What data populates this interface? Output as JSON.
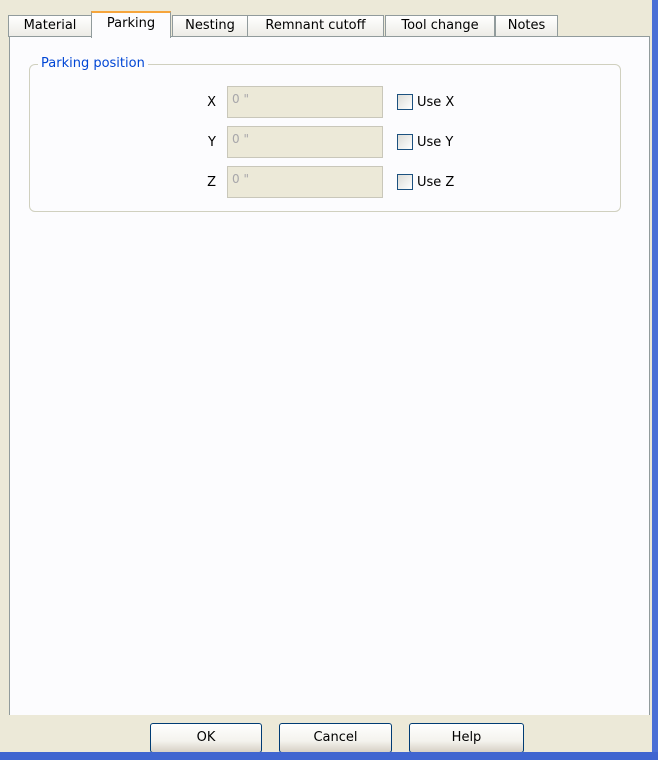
{
  "tabs": [
    "Material",
    "Parking",
    "Nesting",
    "Remnant cutoff",
    "Tool change",
    "Notes"
  ],
  "active_tab": "Parking",
  "group": {
    "title": "Parking position",
    "rows": [
      {
        "axis": "X",
        "value": "0 \"",
        "checkbox_label": "Use X",
        "checked": false
      },
      {
        "axis": "Y",
        "value": "0 \"",
        "checkbox_label": "Use Y",
        "checked": false
      },
      {
        "axis": "Z",
        "value": "0 \"",
        "checkbox_label": "Use Z",
        "checked": false
      }
    ]
  },
  "buttons": {
    "ok": "OK",
    "cancel": "Cancel",
    "help": "Help"
  },
  "colors": {
    "group_title": "#0046d5",
    "active_tab_accent": "#f6a53c",
    "window_border": "#3f65d0"
  }
}
